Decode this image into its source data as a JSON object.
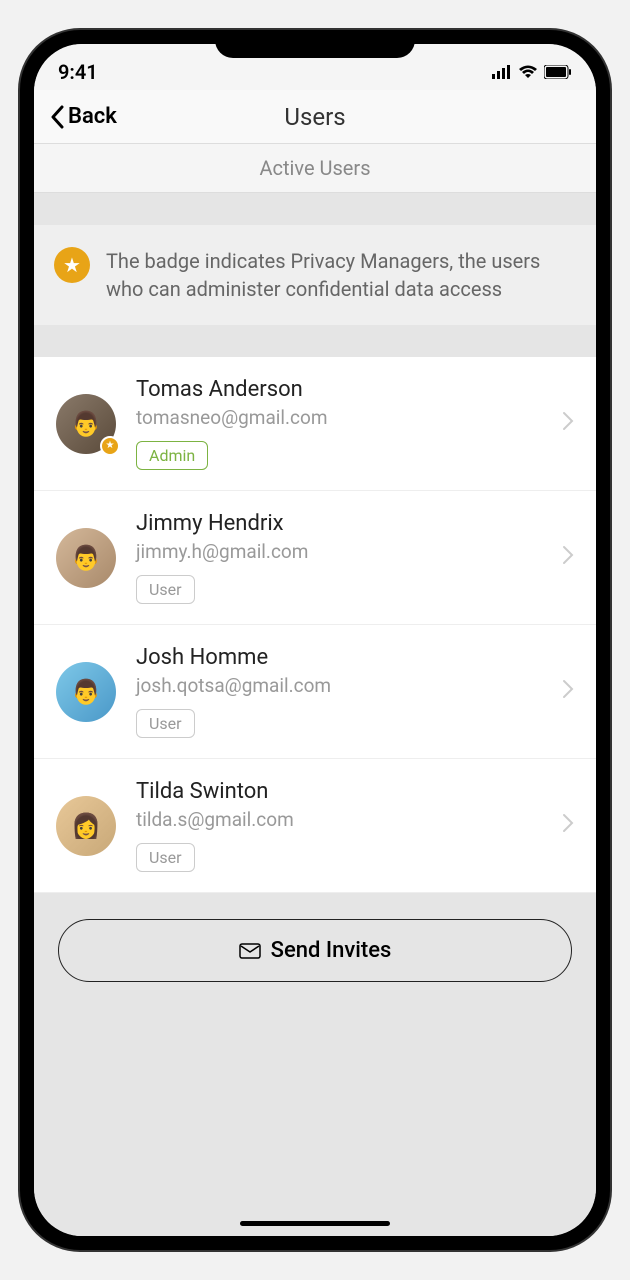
{
  "status": {
    "time": "9:41"
  },
  "nav": {
    "back": "Back",
    "title": "Users"
  },
  "section": {
    "header": "Active Users"
  },
  "info": {
    "text": "The badge indicates Privacy Managers, the users who can administer confidential data access"
  },
  "users": [
    {
      "name": "Tomas Anderson",
      "email": "tomasneo@gmail.com",
      "role": "Admin",
      "hasBadge": true
    },
    {
      "name": "Jimmy Hendrix",
      "email": "jimmy.h@gmail.com",
      "role": "User",
      "hasBadge": false
    },
    {
      "name": "Josh Homme",
      "email": "josh.qotsa@gmail.com",
      "role": "User",
      "hasBadge": false
    },
    {
      "name": "Tilda Swinton",
      "email": "tilda.s@gmail.com",
      "role": "User",
      "hasBadge": false
    }
  ],
  "footer": {
    "inviteLabel": "Send Invites"
  }
}
